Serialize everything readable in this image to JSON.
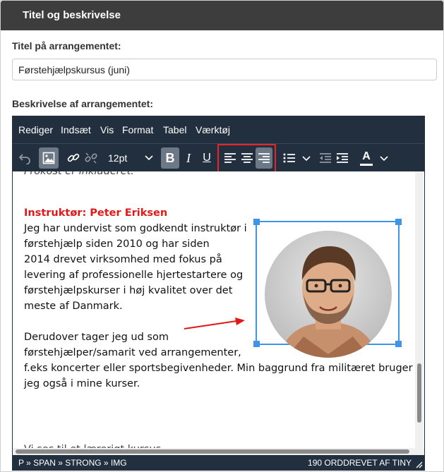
{
  "panel": {
    "header": "Titel og beskrivelse"
  },
  "title_field": {
    "label": "Titel på arrangementet:",
    "value": "Førstehjælpskursus (juni)"
  },
  "description_field": {
    "label": "Beskrivelse af arrangementet:"
  },
  "editor": {
    "menubar": [
      "Rediger",
      "Indsæt",
      "Vis",
      "Format",
      "Tabel",
      "Værktøj"
    ],
    "toolbar": {
      "font_size": "12pt",
      "bold_label": "B",
      "italic_label": "I",
      "underline_label": "U",
      "text_color_label": "A",
      "bold_active": true,
      "image_active": true,
      "align_right_active": true,
      "icons": [
        "undo-icon",
        "image-icon",
        "link-icon",
        "unlink-icon",
        "align-left-icon",
        "align-center-icon",
        "align-right-icon",
        "bullet-list-icon",
        "outdent-icon",
        "indent-icon",
        "text-color-icon"
      ]
    },
    "content": {
      "cutoff_top": "Frokost er inkluderet.",
      "heading": "Instruktør: Peter Eriksen",
      "paragraph1": [
        "Jeg har undervist som godkendt instruktør i",
        "førstehjælp siden 2010 og har siden",
        "2014 drevet virksomhed med fokus på",
        "levering af professionelle hjertestartere og",
        "førstehjælpskurser i høj kvalitet over det",
        "meste af Danmark."
      ],
      "paragraph2": [
        "Derudover tager jeg ud som",
        "førstehjælper/samarit ved arrangementer,",
        "f.eks koncerter eller sportsbegivenheder. Min baggrund fra militæret bruger",
        "jeg også i mine kurser."
      ],
      "cutoff_bottom": "Vi ses til et lærerigt kursus."
    },
    "statusbar": {
      "path": "P » SPAN » STRONG » IMG",
      "wordcount": "190 ORD",
      "brand": "DREVET AF TINY"
    }
  },
  "colors": {
    "header_bg": "#3d3d3d",
    "toolbar_bg": "#222f3e",
    "heading_red": "#e01818",
    "selection_blue": "#3f94e8",
    "highlight_red": "#e8262a"
  }
}
